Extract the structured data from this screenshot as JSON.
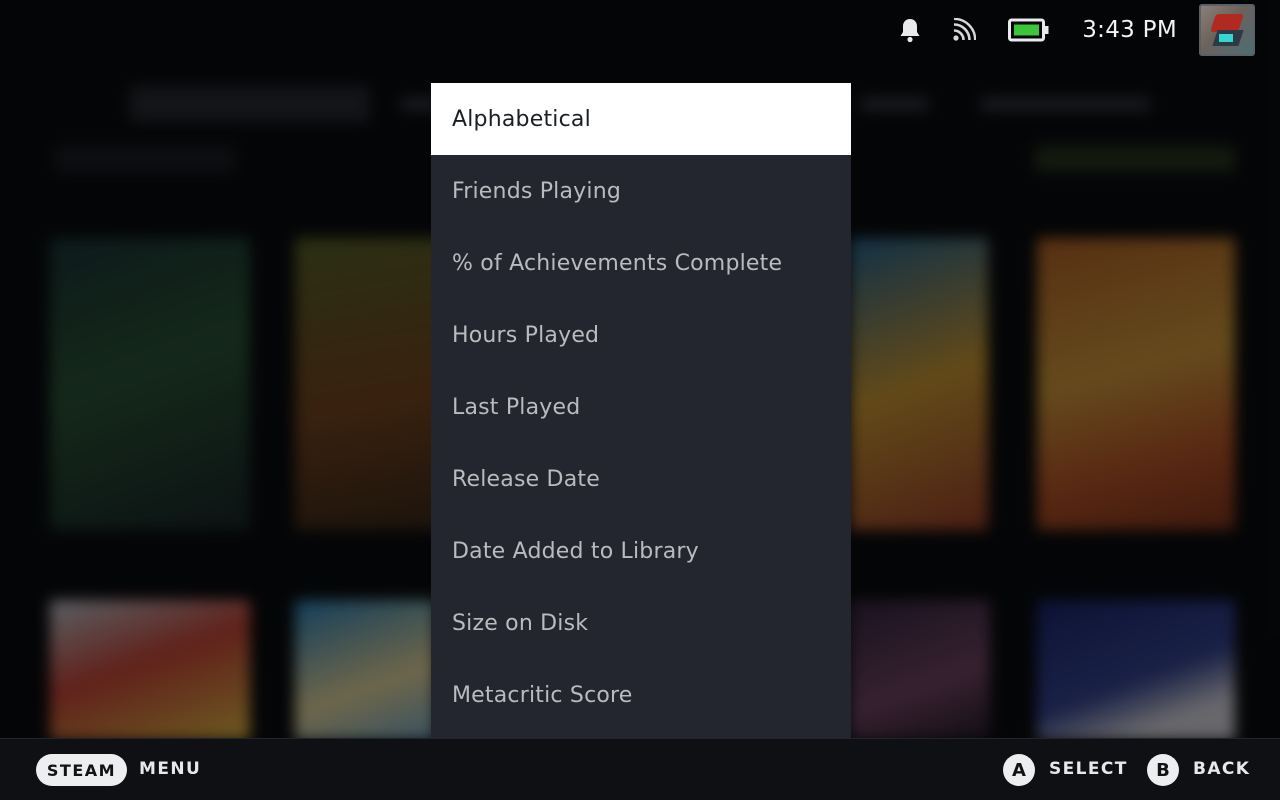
{
  "status_bar": {
    "clock": "3:43 PM",
    "icons": [
      "bell-icon",
      "cast-icon",
      "battery-icon"
    ],
    "battery_color": "#3cc43a"
  },
  "sort_menu": {
    "selected_index": 0,
    "items": [
      "Alphabetical",
      "Friends Playing",
      "% of Achievements Complete",
      "Hours Played",
      "Last Played",
      "Release Date",
      "Date Added to Library",
      "Size on Disk",
      "Metacritic Score"
    ]
  },
  "footer": {
    "steam_label": "STEAM",
    "menu_label": "MENU",
    "a_glyph": "A",
    "select_label": "SELECT",
    "b_glyph": "B",
    "back_label": "BACK"
  },
  "colors": {
    "menu_bg": "#23262e",
    "selected_bg": "#ffffff",
    "page_bg": "#0b0d10"
  }
}
